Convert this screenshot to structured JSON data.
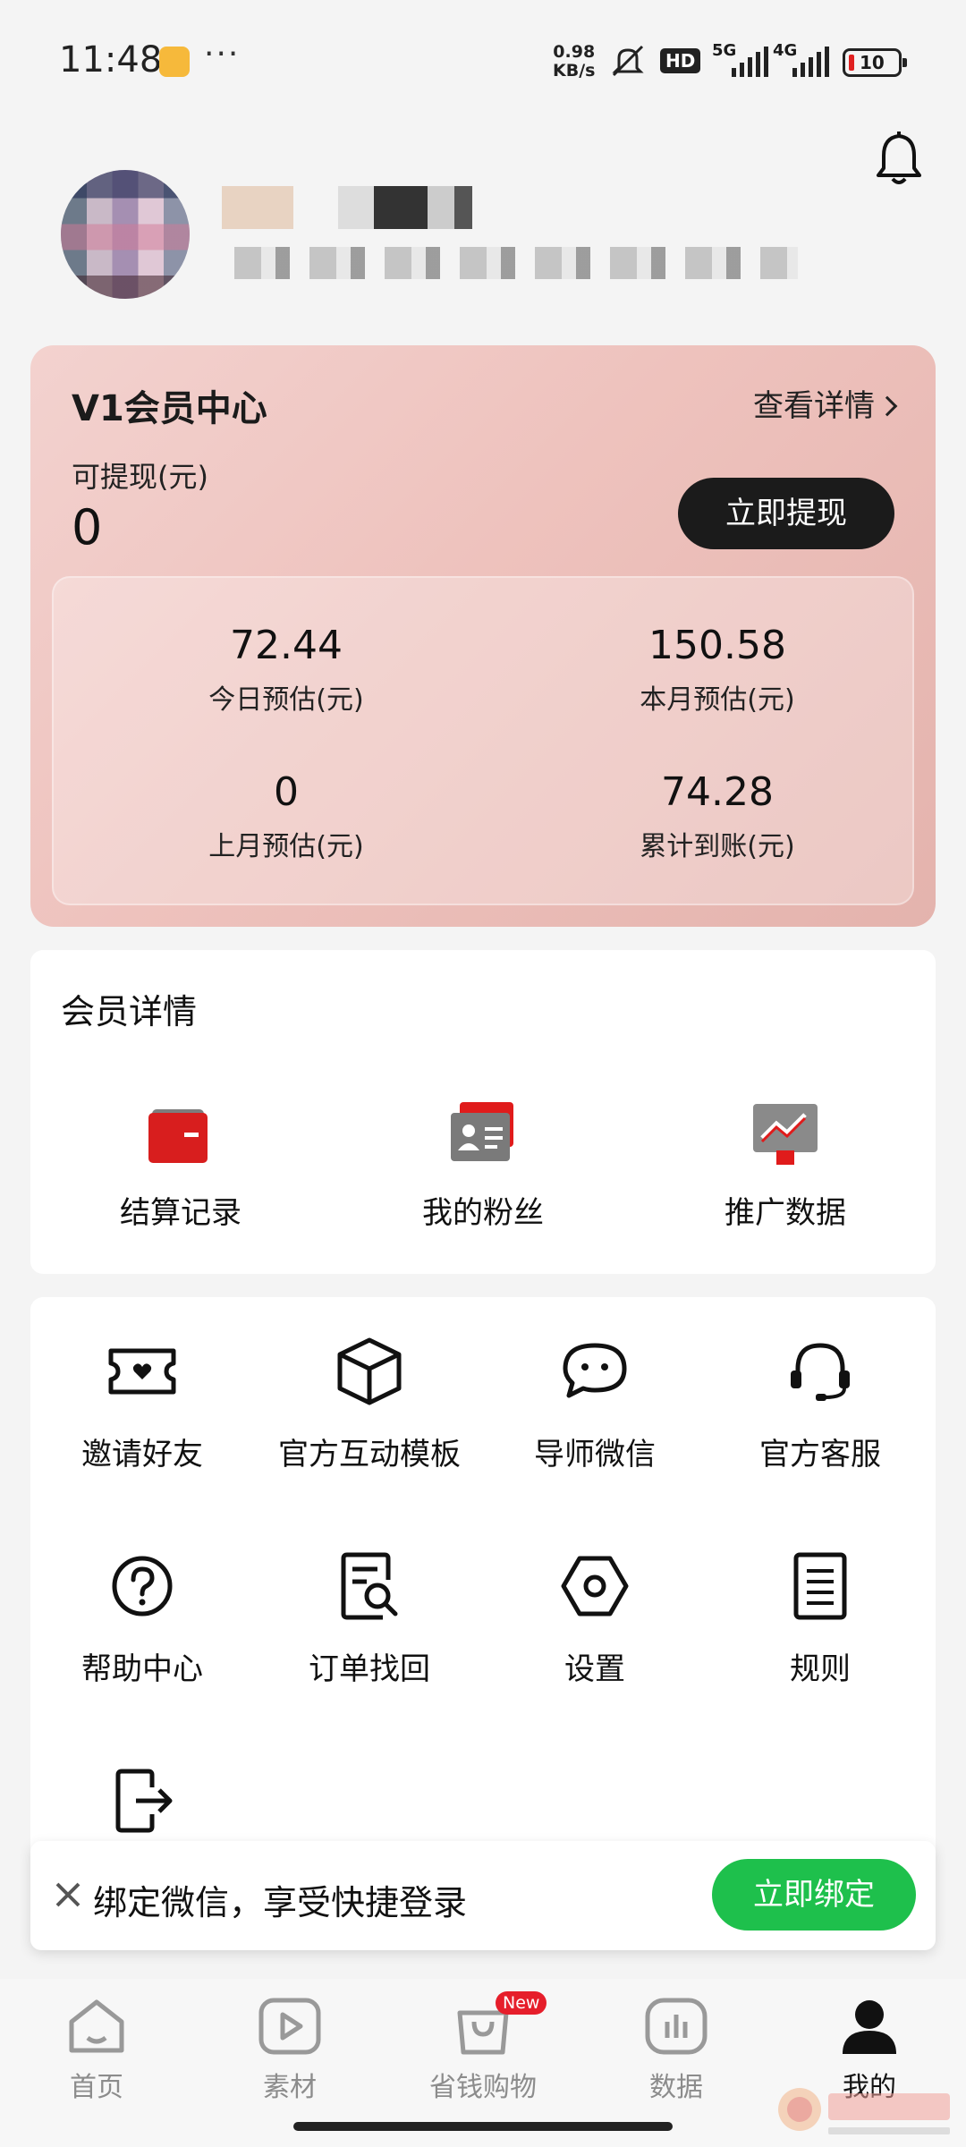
{
  "status_bar": {
    "time": "11:48",
    "speed_value": "0.98",
    "speed_unit": "KB/s",
    "hd_label": "HD",
    "network_1": "5G",
    "network_2": "4G",
    "battery": "10"
  },
  "member_card": {
    "title": "V1会员中心",
    "detail_link": "查看详情",
    "withdrawable_label": "可提现(元)",
    "withdrawable_value": "0",
    "withdraw_button": "立即提现",
    "stats": [
      {
        "value": "72.44",
        "label": "今日预估(元)"
      },
      {
        "value": "150.58",
        "label": "本月预估(元)"
      },
      {
        "value": "0",
        "label": "上月预估(元)"
      },
      {
        "value": "74.28",
        "label": "累计到账(元)"
      }
    ]
  },
  "member_details": {
    "title": "会员详情",
    "items": [
      {
        "label": "结算记录",
        "icon": "wallet-icon"
      },
      {
        "label": "我的粉丝",
        "icon": "id-card-icon"
      },
      {
        "label": "推广数据",
        "icon": "trend-chart-icon"
      }
    ]
  },
  "tools": {
    "items": [
      {
        "label": "邀请好友",
        "icon": "ticket-heart-icon"
      },
      {
        "label": "官方互动模板",
        "icon": "cube-icon"
      },
      {
        "label": "导师微信",
        "icon": "chat-bubble-icon"
      },
      {
        "label": "官方客服",
        "icon": "headset-icon"
      },
      {
        "label": "帮助中心",
        "icon": "question-icon"
      },
      {
        "label": "订单找回",
        "icon": "document-search-icon"
      },
      {
        "label": "设置",
        "icon": "hexagon-gear-icon"
      },
      {
        "label": "规则",
        "icon": "list-document-icon"
      },
      {
        "label": "",
        "icon": "logout-icon"
      }
    ]
  },
  "wechat_banner": {
    "text": "绑定微信，享受快捷登录",
    "button": "立即绑定"
  },
  "bottom_nav": {
    "items": [
      {
        "label": "首页",
        "icon": "home-icon"
      },
      {
        "label": "素材",
        "icon": "play-icon"
      },
      {
        "label": "省钱购物",
        "icon": "shopping-bag-icon",
        "badge": "New"
      },
      {
        "label": "数据",
        "icon": "bar-chart-icon"
      },
      {
        "label": "我的",
        "icon": "user-icon",
        "active": true
      }
    ]
  },
  "colors": {
    "accent_green": "#1ec04c",
    "badge_red": "#e61e2b",
    "card_pink": "#eec2bd"
  }
}
